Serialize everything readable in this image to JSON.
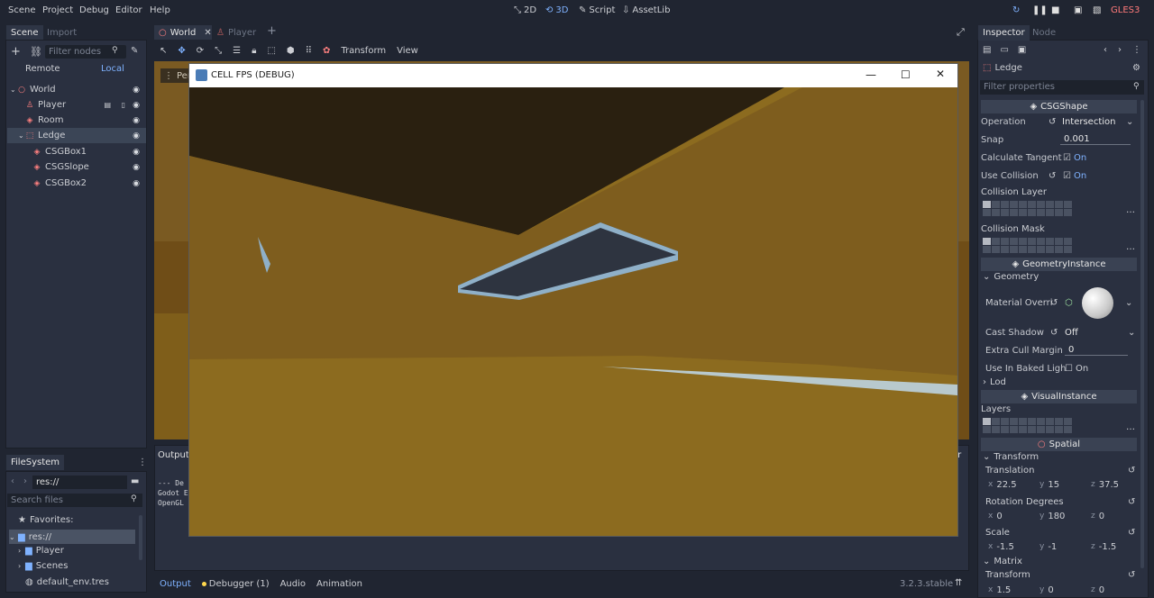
{
  "menubar": {
    "items": [
      "Scene",
      "Project",
      "Debug",
      "Editor",
      "Help"
    ],
    "modes": [
      {
        "label": "2D",
        "icon": "2d-icon"
      },
      {
        "label": "3D",
        "icon": "3d-icon",
        "active": true
      },
      {
        "label": "Script",
        "icon": "script-icon"
      },
      {
        "label": "AssetLib",
        "icon": "assetlib-icon"
      }
    ],
    "renderer": "GLES3"
  },
  "scene_dock": {
    "tabs": [
      "Scene",
      "Import"
    ],
    "filter_placeholder": "Filter nodes",
    "remote": "Remote",
    "local": "Local",
    "tree": [
      {
        "label": "World",
        "icon": "spatial-icon",
        "depth": 0,
        "color": "#fc7f7f"
      },
      {
        "label": "Player",
        "icon": "kinematic-icon",
        "depth": 1,
        "color": "#fc7f7f"
      },
      {
        "label": "Room",
        "icon": "csg-icon",
        "depth": 1,
        "color": "#fc7f7f"
      },
      {
        "label": "Ledge",
        "icon": "csg-combiner-icon",
        "depth": 1,
        "selected": true,
        "color": "#fc7f7f"
      },
      {
        "label": "CSGBox1",
        "icon": "csg-box-icon",
        "depth": 2,
        "color": "#fc7f7f"
      },
      {
        "label": "CSGSlope",
        "icon": "csg-polygon-icon",
        "depth": 2,
        "color": "#fc7f7f"
      },
      {
        "label": "CSGBox2",
        "icon": "csg-box-icon",
        "depth": 2,
        "color": "#fc7f7f"
      }
    ]
  },
  "filesystem": {
    "title": "FileSystem",
    "path": "res://",
    "search_placeholder": "Search files",
    "favorites": "Favorites:",
    "items": [
      {
        "label": "res://",
        "type": "folder",
        "depth": 0,
        "selected": true
      },
      {
        "label": "Player",
        "type": "folder",
        "depth": 1
      },
      {
        "label": "Scenes",
        "type": "folder",
        "depth": 1
      },
      {
        "label": "default_env.tres",
        "type": "resource",
        "depth": 1
      }
    ]
  },
  "editor_tabs": [
    {
      "label": "World",
      "active": true
    },
    {
      "label": "Player",
      "active": false
    }
  ],
  "viewport_toolbar": {
    "transform": "Transform",
    "view": "View",
    "perspective": "Pers"
  },
  "game_window": {
    "title": "CELL FPS (DEBUG)"
  },
  "output": {
    "label": "Output:",
    "lines": [
      "--- De",
      "Godot E",
      "OpenGL "
    ]
  },
  "bottom_tabs": [
    {
      "label": "Output",
      "active": true
    },
    {
      "label": "Debugger (1)",
      "dot": true
    },
    {
      "label": "Audio"
    },
    {
      "label": "Animation"
    }
  ],
  "version": "3.2.3.stable",
  "inspector": {
    "tabs": [
      "Inspector",
      "Node"
    ],
    "node_name": "Ledge",
    "filter_placeholder": "Filter properties",
    "sections": {
      "csgshape": "CSGShape",
      "geometry_instance": "GeometryInstance",
      "geometry": "Geometry",
      "lod": "Lod",
      "visual_instance": "VisualInstance",
      "spatial": "Spatial",
      "transform": "Transform",
      "matrix": "Matrix"
    },
    "props": {
      "operation": {
        "label": "Operation",
        "value": "Intersection"
      },
      "snap": {
        "label": "Snap",
        "value": "0.001"
      },
      "calc_tangent": {
        "label": "Calculate Tangent",
        "value": "On"
      },
      "use_collision": {
        "label": "Use Collision",
        "value": "On"
      },
      "collision_layer": {
        "label": "Collision Layer"
      },
      "collision_mask": {
        "label": "Collision Mask"
      },
      "material_override": {
        "label": "Material Overri"
      },
      "cast_shadow": {
        "label": "Cast Shadow",
        "value": "Off"
      },
      "extra_cull": {
        "label": "Extra Cull Margin",
        "value": "0"
      },
      "baked_light": {
        "label": "Use In Baked Ligh",
        "value": "On"
      },
      "layers": {
        "label": "Layers"
      },
      "translation": {
        "label": "Translation",
        "x": "22.5",
        "y": "15",
        "z": "37.5"
      },
      "rotation": {
        "label": "Rotation Degrees",
        "x": "0",
        "y": "180",
        "z": "0"
      },
      "scale": {
        "label": "Scale",
        "x": "-1.5",
        "y": "-1",
        "z": "-1.5"
      },
      "matrix_transform": {
        "label": "Transform",
        "x": "1.5",
        "y": "0",
        "z": "0"
      }
    }
  }
}
